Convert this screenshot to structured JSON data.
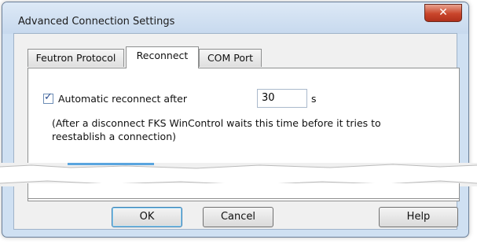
{
  "window": {
    "title": "Advanced Connection Settings",
    "close_glyph": "✕"
  },
  "tabs": [
    {
      "label": "Feutron Protocol",
      "active": false
    },
    {
      "label": "Reconnect",
      "active": true
    },
    {
      "label": "COM Port",
      "active": false
    }
  ],
  "reconnect": {
    "auto_checked": true,
    "auto_label": "Automatic reconnect after",
    "seconds_value": "30",
    "unit": "s",
    "description_line1": "(After a disconnect FKS WinControl waits this time before it tries to",
    "description_line2": "reestablish a connection)"
  },
  "buttons": {
    "ok": "OK",
    "cancel": "Cancel",
    "help": "Help"
  }
}
